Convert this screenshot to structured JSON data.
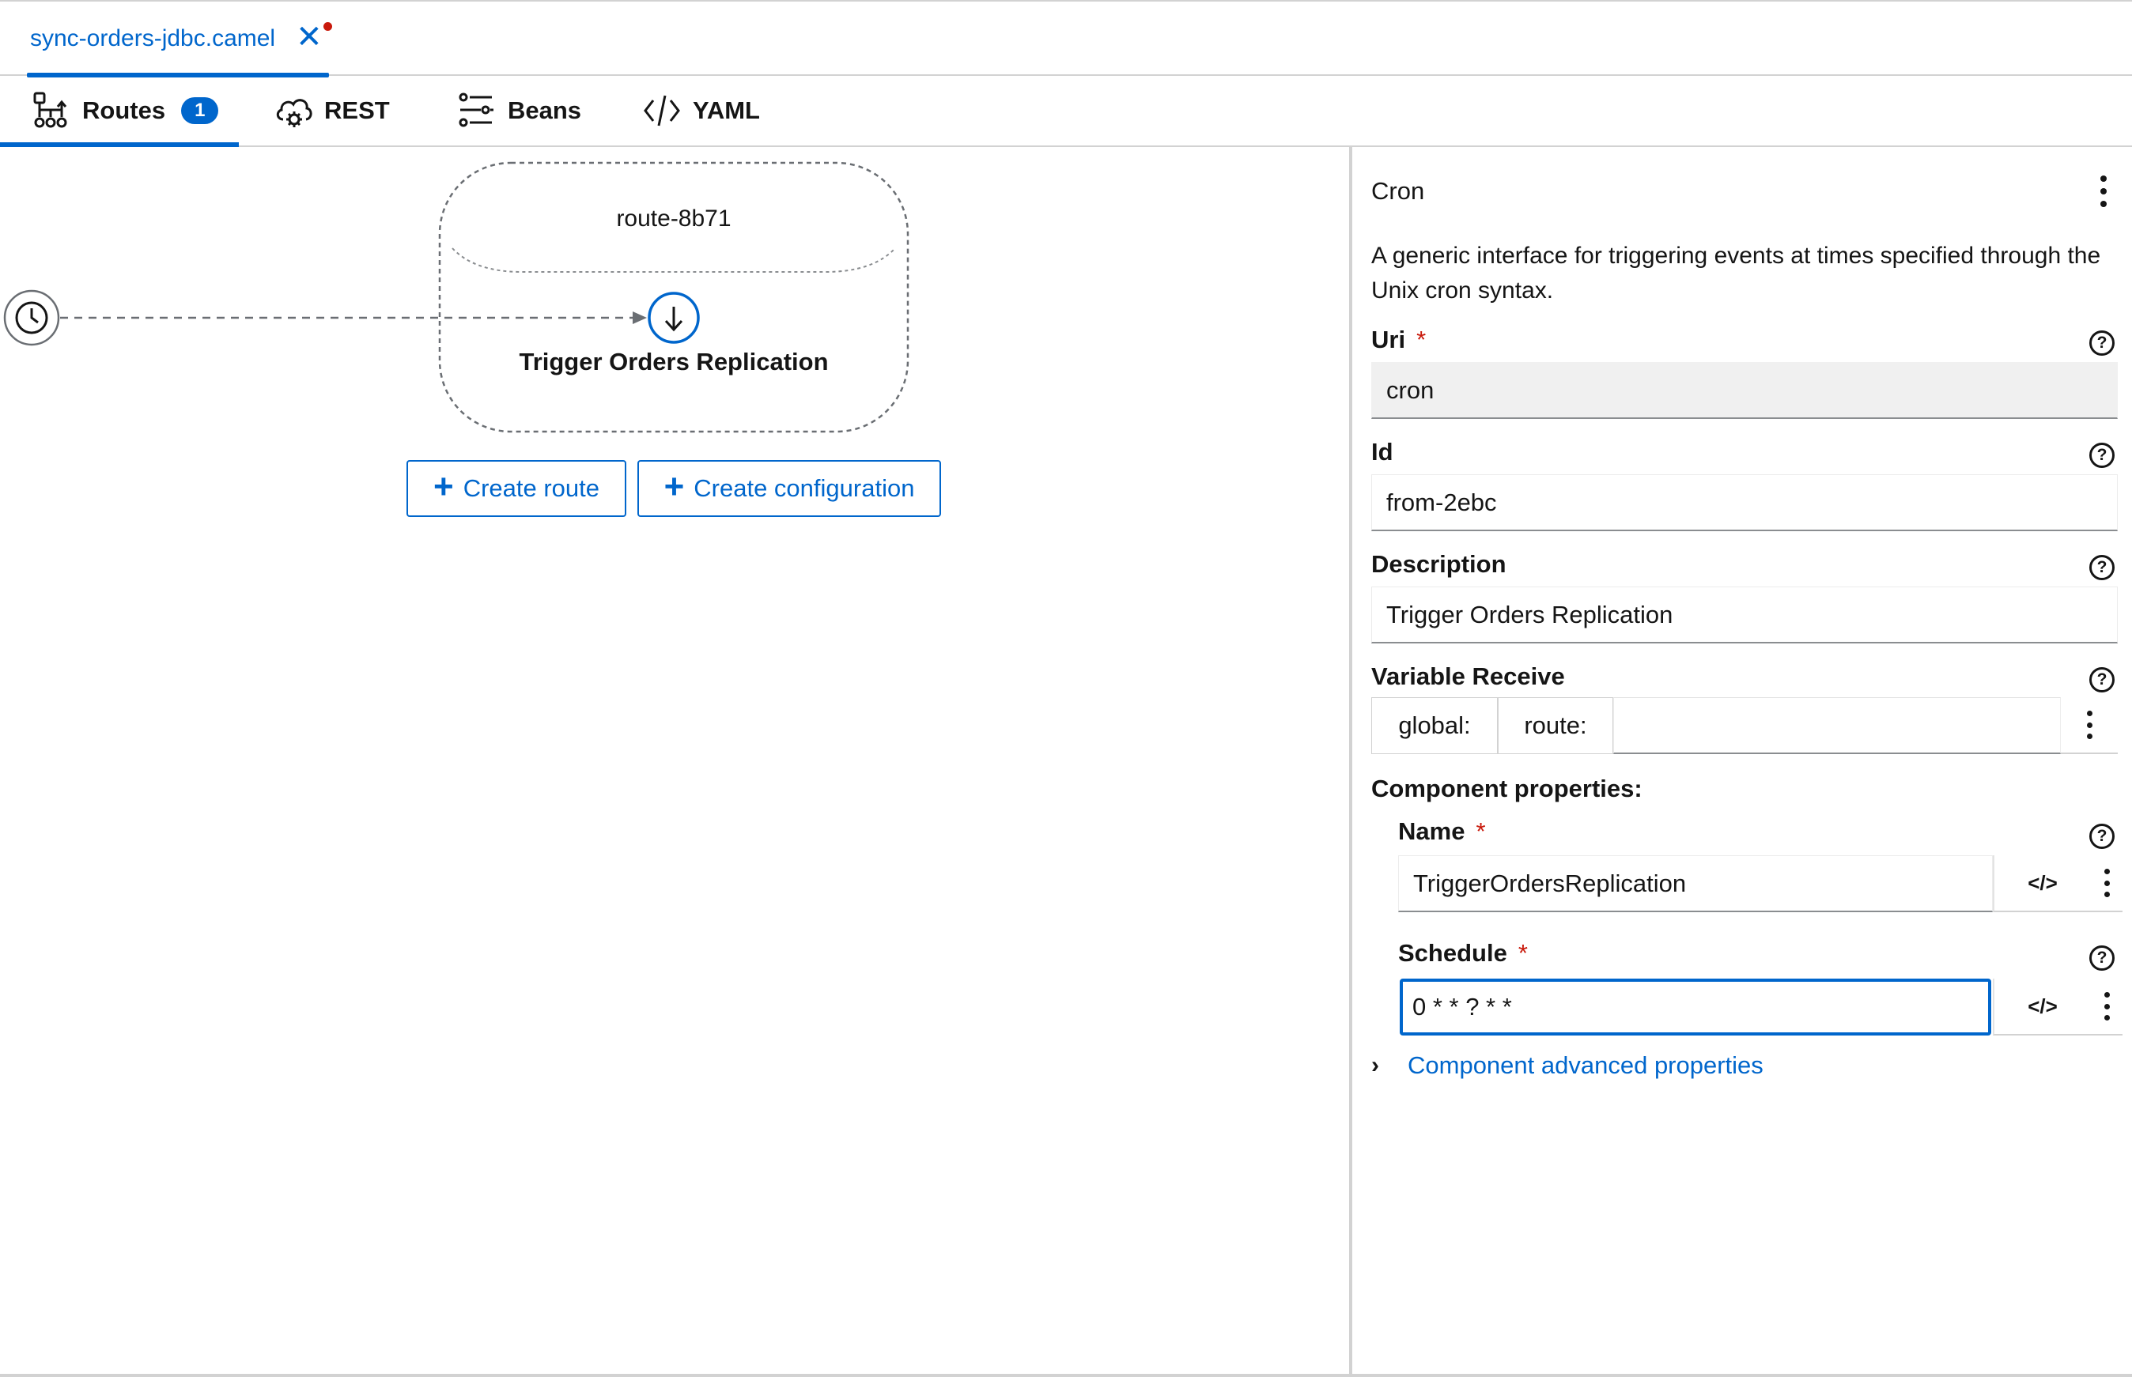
{
  "file_tab": {
    "name": "sync-orders-jdbc.camel",
    "close_glyph": "✕",
    "modified": true
  },
  "view_tabs": [
    {
      "label": "Routes",
      "icon": "routes-icon",
      "badge": "1",
      "active": true
    },
    {
      "label": "REST",
      "icon": "rest-cloud-icon"
    },
    {
      "label": "Beans",
      "icon": "beans-icon"
    },
    {
      "label": "YAML",
      "icon": "code-icon"
    }
  ],
  "canvas": {
    "route_name": "route-8b71",
    "step_label": "Trigger Orders Replication",
    "buttons": {
      "create_route": "Create route",
      "create_configuration": "Create configuration",
      "plus": "+"
    }
  },
  "panel": {
    "title": "Cron",
    "description": "A generic interface for triggering events at times specified through the Unix cron syntax.",
    "help_glyph": "?",
    "required_mark": "*",
    "uri": {
      "label": "Uri",
      "value": "cron"
    },
    "id": {
      "label": "Id",
      "value": "from-2ebc"
    },
    "description_field": {
      "label": "Description",
      "value": "Trigger Orders Replication"
    },
    "variable_receive": {
      "label": "Variable Receive",
      "global": "global:",
      "route": "route:",
      "value": ""
    },
    "component_properties": {
      "label": "Component properties:",
      "name": {
        "label": "Name",
        "value": "TriggerOrdersReplication"
      },
      "schedule": {
        "label": "Schedule",
        "value": "0 * * ? * *"
      },
      "code_glyph": "</>"
    },
    "advanced": {
      "chevron": "›",
      "label": "Component advanced properties"
    }
  },
  "colors": {
    "accent": "#0066cc",
    "required": "#c9190b",
    "border": "#d2d2d2",
    "readonly_bg": "#f0f0f0"
  }
}
